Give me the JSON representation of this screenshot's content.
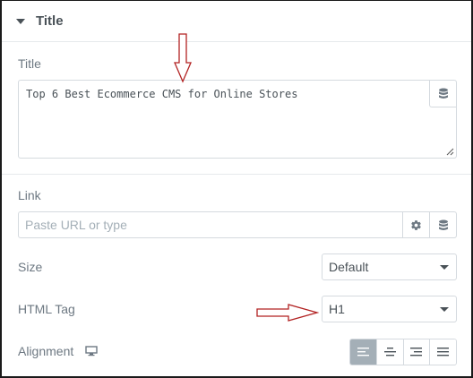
{
  "section": {
    "title": "Title"
  },
  "title_field": {
    "label": "Title",
    "value": "Top 6 Best Ecommerce CMS for Online Stores"
  },
  "link_field": {
    "label": "Link",
    "placeholder": "Paste URL or type"
  },
  "size_field": {
    "label": "Size",
    "value": "Default"
  },
  "html_tag_field": {
    "label": "HTML Tag",
    "value": "H1"
  },
  "alignment_field": {
    "label": "Alignment",
    "options": [
      "left",
      "center",
      "right",
      "justify"
    ],
    "selected": "left"
  },
  "colors": {
    "accent_arrow": "#b22222",
    "active_toggle": "#a4afb7"
  }
}
